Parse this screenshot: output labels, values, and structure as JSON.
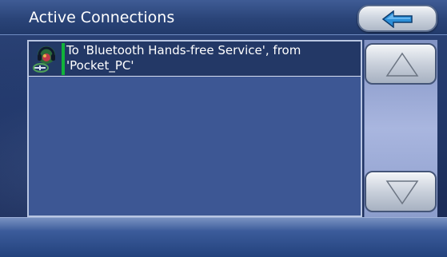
{
  "header": {
    "title": "Active Connections",
    "back_button_icon": "back-arrow-icon"
  },
  "connections": [
    {
      "icon": "bluetooth-connection-icon",
      "text": "To 'Bluetooth Hands-free Service', from 'Pocket_PC'"
    }
  ],
  "scroll": {
    "up_icon": "triangle-up-icon",
    "down_icon": "triangle-down-icon"
  },
  "colors": {
    "accent_arrow": "#2c8fd8",
    "status_bar": "#11b33a",
    "background": "#22386a"
  }
}
